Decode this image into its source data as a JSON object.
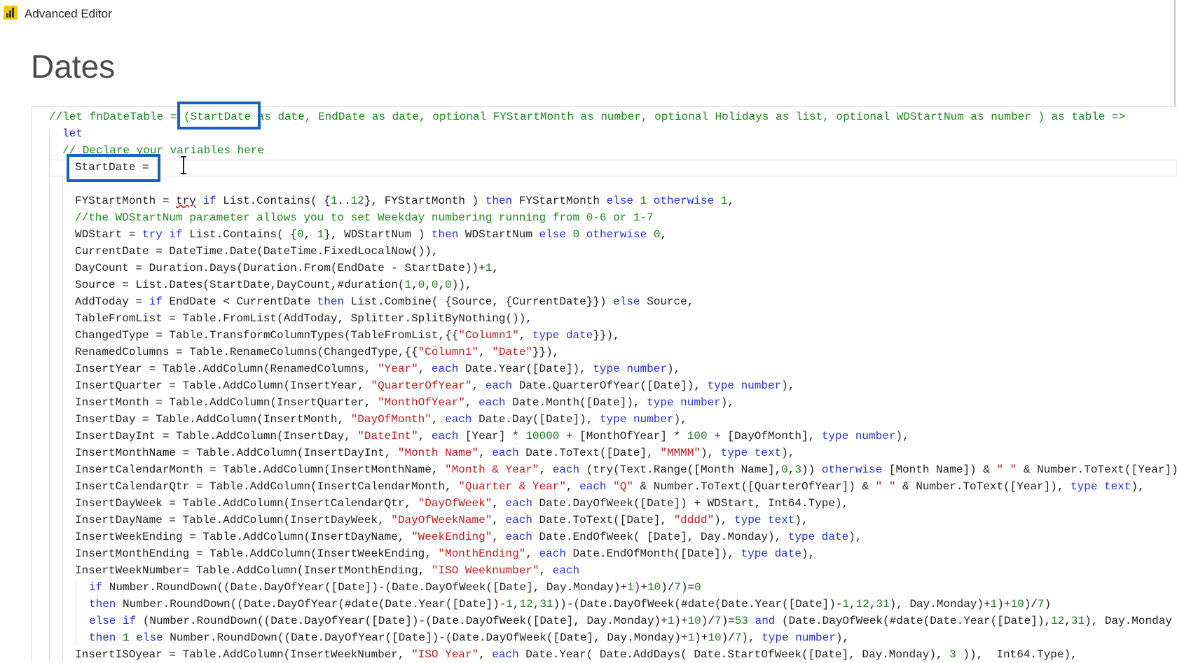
{
  "window": {
    "title": "Advanced Editor",
    "icon": "power-bi-icon"
  },
  "query": {
    "name": "Dates"
  },
  "colors": {
    "keyword": "#2233d9",
    "string": "#c81818",
    "number": "#1a7a1a",
    "comment": "#1a8a1a",
    "highlight_box": "#1565c0"
  },
  "code_lines": [
    [
      [
        "cm",
        "//let fnDateTable = (StartDate as date, EndDate as date, optional FYStartMonth as number, optional Holidays as list, optional WDStartNum as number ) as table =>"
      ]
    ],
    [
      [
        "kw",
        "let"
      ]
    ],
    [
      [
        "cm",
        "// Declare your variables here"
      ]
    ],
    [
      [
        "",
        "StartDate ="
      ]
    ],
    [],
    [
      [
        "",
        "FYStartMonth = "
      ],
      [
        "err",
        "try"
      ],
      [
        "",
        ""
      ],
      [
        "kw",
        " if"
      ],
      [
        "",
        " List.Contains( {"
      ],
      [
        "num",
        "1"
      ],
      [
        "",
        ".."
      ],
      [
        "num",
        "12"
      ],
      [
        "",
        "}, FYStartMonth ) "
      ],
      [
        "kw",
        "then"
      ],
      [
        "",
        " FYStartMonth "
      ],
      [
        "kw",
        "else"
      ],
      [
        "",
        " "
      ],
      [
        "num",
        "1"
      ],
      [
        "",
        " "
      ],
      [
        "kw",
        "otherwise"
      ],
      [
        "",
        " "
      ],
      [
        "num",
        "1"
      ],
      [
        "",
        ","
      ]
    ],
    [
      [
        "cm",
        "//the WDStartNum parameter allows you to set Weekday numbering running from 0-6 or 1-7"
      ]
    ],
    [
      [
        "",
        "WDStart = "
      ],
      [
        "kw",
        "try"
      ],
      [
        "",
        ""
      ],
      [
        "kw",
        " if"
      ],
      [
        "",
        " List.Contains( {"
      ],
      [
        "num",
        "0"
      ],
      [
        "",
        ", "
      ],
      [
        "num",
        "1"
      ],
      [
        "",
        "}, WDStartNum ) "
      ],
      [
        "kw",
        "then"
      ],
      [
        "",
        " WDStartNum "
      ],
      [
        "kw",
        "else"
      ],
      [
        "",
        " "
      ],
      [
        "num",
        "0"
      ],
      [
        "",
        " "
      ],
      [
        "kw",
        "otherwise"
      ],
      [
        "",
        " "
      ],
      [
        "num",
        "0"
      ],
      [
        "",
        ","
      ]
    ],
    [
      [
        "",
        "CurrentDate = DateTime.Date(DateTime.FixedLocalNow()),"
      ]
    ],
    [
      [
        "",
        "DayCount = Duration.Days(Duration.From(EndDate - StartDate))+"
      ],
      [
        "num",
        "1"
      ],
      [
        "",
        ","
      ]
    ],
    [
      [
        "",
        "Source = List.Dates(StartDate,DayCount,#duration("
      ],
      [
        "num",
        "1"
      ],
      [
        "",
        ","
      ],
      [
        "num",
        "0"
      ],
      [
        "",
        ","
      ],
      [
        "num",
        "0"
      ],
      [
        "",
        ","
      ],
      [
        "num",
        "0"
      ],
      [
        "",
        "))"
      ],
      [
        "",
        ","
      ]
    ],
    [
      [
        "",
        "AddToday = "
      ],
      [
        "kw",
        "if"
      ],
      [
        "",
        " EndDate < CurrentDate "
      ],
      [
        "kw",
        "then"
      ],
      [
        "",
        " List.Combine( {Source, {CurrentDate}}) "
      ],
      [
        "kw",
        "else"
      ],
      [
        "",
        " Source,"
      ]
    ],
    [
      [
        "",
        "TableFromList = Table.FromList(AddToday, Splitter.SplitByNothing()),"
      ]
    ],
    [
      [
        "",
        "ChangedType = Table.TransformColumnTypes(TableFromList,{{"
      ],
      [
        "str",
        "\"Column1\""
      ],
      [
        "",
        ", "
      ],
      [
        "kw",
        "type"
      ],
      [
        "",
        " "
      ],
      [
        "kw",
        "date"
      ],
      [
        "",
        "}}),"
      ]
    ],
    [
      [
        "",
        "RenamedColumns = Table.RenameColumns(ChangedType,{{"
      ],
      [
        "str",
        "\"Column1\""
      ],
      [
        "",
        ", "
      ],
      [
        "str",
        "\"Date\""
      ],
      [
        "",
        "}}),"
      ]
    ],
    [
      [
        "",
        "InsertYear = Table.AddColumn(RenamedColumns, "
      ],
      [
        "str",
        "\"Year\""
      ],
      [
        "",
        ", "
      ],
      [
        "kw",
        "each"
      ],
      [
        "",
        " Date.Year([Date]), "
      ],
      [
        "kw",
        "type"
      ],
      [
        "",
        " "
      ],
      [
        "kw",
        "number"
      ],
      [
        "",
        "),"
      ]
    ],
    [
      [
        "",
        "InsertQuarter = Table.AddColumn(InsertYear, "
      ],
      [
        "str",
        "\"QuarterOfYear\""
      ],
      [
        "",
        ", "
      ],
      [
        "kw",
        "each"
      ],
      [
        "",
        " Date.QuarterOfYear([Date]), "
      ],
      [
        "kw",
        "type"
      ],
      [
        "",
        " "
      ],
      [
        "kw",
        "number"
      ],
      [
        "",
        "),"
      ]
    ],
    [
      [
        "",
        "InsertMonth = Table.AddColumn(InsertQuarter, "
      ],
      [
        "str",
        "\"MonthOfYear\""
      ],
      [
        "",
        ", "
      ],
      [
        "kw",
        "each"
      ],
      [
        "",
        " Date.Month([Date]), "
      ],
      [
        "kw",
        "type"
      ],
      [
        "",
        " "
      ],
      [
        "kw",
        "number"
      ],
      [
        "",
        "),"
      ]
    ],
    [
      [
        "",
        "InsertDay = Table.AddColumn(InsertMonth, "
      ],
      [
        "str",
        "\"DayOfMonth\""
      ],
      [
        "",
        ", "
      ],
      [
        "kw",
        "each"
      ],
      [
        "",
        " Date.Day([Date]), "
      ],
      [
        "kw",
        "type"
      ],
      [
        "",
        " "
      ],
      [
        "kw",
        "number"
      ],
      [
        "",
        "),"
      ]
    ],
    [
      [
        "",
        "InsertDayInt = Table.AddColumn(InsertDay, "
      ],
      [
        "str",
        "\"DateInt\""
      ],
      [
        "",
        ", "
      ],
      [
        "kw",
        "each"
      ],
      [
        "",
        " [Year] * "
      ],
      [
        "num",
        "10000"
      ],
      [
        "",
        " + [MonthOfYear] * "
      ],
      [
        "num",
        "100"
      ],
      [
        "",
        " + [DayOfMonth], "
      ],
      [
        "kw",
        "type"
      ],
      [
        "",
        " "
      ],
      [
        "kw",
        "number"
      ],
      [
        "",
        "),"
      ]
    ],
    [
      [
        "",
        "InsertMonthName = Table.AddColumn(InsertDayInt, "
      ],
      [
        "str",
        "\"Month Name\""
      ],
      [
        "",
        ", "
      ],
      [
        "kw",
        "each"
      ],
      [
        "",
        " Date.ToText([Date], "
      ],
      [
        "str",
        "\"MMMM\""
      ],
      [
        "",
        "), "
      ],
      [
        "kw",
        "type"
      ],
      [
        "",
        " "
      ],
      [
        "kw",
        "text"
      ],
      [
        "",
        "),"
      ]
    ],
    [
      [
        "",
        "InsertCalendarMonth = Table.AddColumn(InsertMonthName, "
      ],
      [
        "str",
        "\"Month & Year\""
      ],
      [
        "",
        ", "
      ],
      [
        "kw",
        "each"
      ],
      [
        "",
        " (try(Text.Range([Month Name],"
      ],
      [
        "num",
        "0"
      ],
      [
        "",
        ","
      ],
      [
        "num",
        "3"
      ],
      [
        "",
        ")) "
      ],
      [
        "kw",
        "otherwise"
      ],
      [
        "",
        " [Month Name]) & "
      ],
      [
        "str",
        "\" \""
      ],
      [
        "",
        " & Number.ToText([Year])"
      ]
    ],
    [
      [
        "",
        "InsertCalendarQtr = Table.AddColumn(InsertCalendarMonth, "
      ],
      [
        "str",
        "\"Quarter & Year\""
      ],
      [
        "",
        ", "
      ],
      [
        "kw",
        "each"
      ],
      [
        "",
        " "
      ],
      [
        "str",
        "\"Q\""
      ],
      [
        "",
        " & Number.ToText([QuarterOfYear]) & "
      ],
      [
        "str",
        "\" \""
      ],
      [
        "",
        " & Number.ToText([Year]), "
      ],
      [
        "kw",
        "type"
      ],
      [
        "",
        " "
      ],
      [
        "kw",
        "text"
      ],
      [
        "",
        "),"
      ]
    ],
    [
      [
        "",
        "InsertDayWeek = Table.AddColumn(InsertCalendarQtr, "
      ],
      [
        "str",
        "\"DayOfWeek\""
      ],
      [
        "",
        ", "
      ],
      [
        "kw",
        "each"
      ],
      [
        "",
        " Date.DayOfWeek([Date]) + WDStart, Int64.Type),"
      ]
    ],
    [
      [
        "",
        "InsertDayName = Table.AddColumn(InsertDayWeek, "
      ],
      [
        "str",
        "\"DayOfWeekName\""
      ],
      [
        "",
        ", "
      ],
      [
        "kw",
        "each"
      ],
      [
        "",
        " Date.ToText([Date], "
      ],
      [
        "str",
        "\"dddd\""
      ],
      [
        "",
        "), "
      ],
      [
        "kw",
        "type"
      ],
      [
        "",
        " "
      ],
      [
        "kw",
        "text"
      ],
      [
        "",
        "),"
      ]
    ],
    [
      [
        "",
        "InsertWeekEnding = Table.AddColumn(InsertDayName, "
      ],
      [
        "str",
        "\"WeekEnding\""
      ],
      [
        "",
        ", "
      ],
      [
        "kw",
        "each"
      ],
      [
        "",
        " Date.EndOfWeek( [Date], Day.Monday), "
      ],
      [
        "kw",
        "type"
      ],
      [
        "",
        " "
      ],
      [
        "kw",
        "date"
      ],
      [
        "",
        "),"
      ]
    ],
    [
      [
        "",
        "InsertMonthEnding = Table.AddColumn(InsertWeekEnding, "
      ],
      [
        "str",
        "\"MonthEnding\""
      ],
      [
        "",
        ", "
      ],
      [
        "kw",
        "each"
      ],
      [
        "",
        " Date.EndOfMonth([Date]), "
      ],
      [
        "kw",
        "type"
      ],
      [
        "",
        " "
      ],
      [
        "kw",
        "date"
      ],
      [
        "",
        "),"
      ]
    ],
    [
      [
        "",
        "InsertWeekNumber= Table.AddColumn(InsertMonthEnding, "
      ],
      [
        "str",
        "\"ISO Weeknumber\""
      ],
      [
        "",
        ", "
      ],
      [
        "kw",
        "each"
      ]
    ],
    [
      [
        "kw",
        "if"
      ],
      [
        "",
        " Number.RoundDown((Date.DayOfYear([Date])-(Date.DayOfWeek([Date], Day.Monday)+"
      ],
      [
        "num",
        "1"
      ],
      [
        "",
        ")+"
      ],
      [
        "num",
        "10"
      ],
      [
        "",
        ")/"
      ],
      [
        "num",
        "7"
      ],
      [
        "",
        ")="
      ],
      [
        "num",
        "0"
      ]
    ],
    [
      [
        "kw",
        "then"
      ],
      [
        "",
        " Number.RoundDown((Date.DayOfYear(#date(Date.Year([Date])-"
      ],
      [
        "num",
        "1"
      ],
      [
        "",
        ","
      ],
      [
        "num",
        "12"
      ],
      [
        "",
        ","
      ],
      [
        "num",
        "31"
      ],
      [
        "",
        "))-(Date.DayOfWeek(#date(Date.Year([Date])-"
      ],
      [
        "num",
        "1"
      ],
      [
        "",
        ","
      ],
      [
        "num",
        "12"
      ],
      [
        "",
        ","
      ],
      [
        "num",
        "31"
      ],
      [
        "",
        "), Day.Monday)+"
      ],
      [
        "num",
        "1"
      ],
      [
        "",
        ")+"
      ],
      [
        "num",
        "10"
      ],
      [
        "",
        ")/"
      ],
      [
        "num",
        "7"
      ],
      [
        "",
        ")"
      ]
    ],
    [
      [
        "kw",
        "else if"
      ],
      [
        "",
        " (Number.RoundDown((Date.DayOfYear([Date])-(Date.DayOfWeek([Date], Day.Monday)+"
      ],
      [
        "num",
        "1"
      ],
      [
        "",
        ")+"
      ],
      [
        "num",
        "10"
      ],
      [
        "",
        ")/"
      ],
      [
        "num",
        "7"
      ],
      [
        "",
        ")="
      ],
      [
        "num",
        "53"
      ],
      [
        "",
        " "
      ],
      [
        "kw",
        "and"
      ],
      [
        "",
        " (Date.DayOfWeek(#date(Date.Year([Date]),"
      ],
      [
        "num",
        "12"
      ],
      [
        "",
        ","
      ],
      [
        "num",
        "31"
      ],
      [
        "",
        "), Day.Monday"
      ]
    ],
    [
      [
        "kw",
        "then"
      ],
      [
        "",
        " "
      ],
      [
        "num",
        "1"
      ],
      [
        "",
        " "
      ],
      [
        "kw",
        "else"
      ],
      [
        "",
        " Number.RoundDown((Date.DayOfYear([Date])-(Date.DayOfWeek([Date], Day.Monday)+"
      ],
      [
        "num",
        "1"
      ],
      [
        "",
        ")+"
      ],
      [
        "num",
        "10"
      ],
      [
        "",
        ")/"
      ],
      [
        "num",
        "7"
      ],
      [
        "",
        "), "
      ],
      [
        "kw",
        "type"
      ],
      [
        "",
        " "
      ],
      [
        "kw",
        "number"
      ],
      [
        "",
        "),"
      ]
    ],
    [
      [
        "",
        "InsertISOyear = Table.AddColumn(InsertWeekNumber, "
      ],
      [
        "str",
        "\"ISO Year\""
      ],
      [
        "",
        ", "
      ],
      [
        "kw",
        "each"
      ],
      [
        "",
        " Date.Year( Date.AddDays( Date.StartOfWeek([Date], Day.Monday), "
      ],
      [
        "num",
        "3"
      ],
      [
        "",
        " )),  Int64.Type),"
      ]
    ]
  ]
}
